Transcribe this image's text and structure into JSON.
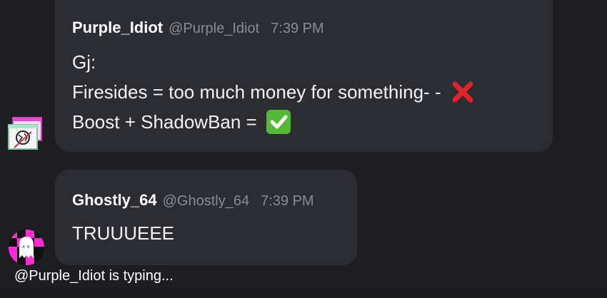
{
  "messages": [
    {
      "author": "Purple_Idiot",
      "handle": "@Purple_Idiot",
      "time": "7:39 PM",
      "lines": [
        "Gj:",
        "Firesides = too much money for something- -",
        "Boost + ShadowBan ="
      ],
      "emojis": [
        "cross-mark-emoji",
        "check-mark-button-emoji"
      ]
    },
    {
      "author": "Ghostly_64",
      "handle": "@Ghostly_64",
      "time": "7:39 PM",
      "lines": [
        "TRUUUEEE"
      ]
    }
  ],
  "typing_indicator": "@Purple_Idiot is typing...",
  "colors": {
    "background": "#1d1d22",
    "bubble": "#2c2c33",
    "muted_text": "#8b8b94",
    "cross_red": "#e0242c",
    "check_green": "#55b938",
    "ghost_avatar_pink": "#ff2bd6"
  }
}
